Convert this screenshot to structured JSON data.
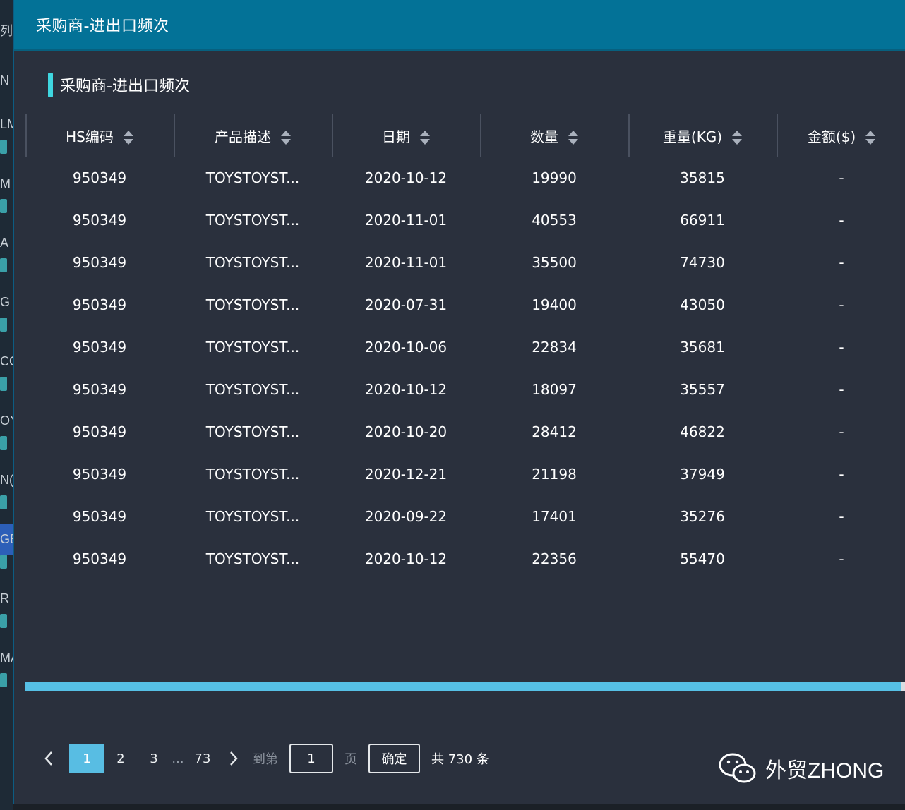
{
  "background_fragments": [
    "列",
    "N",
    "LM",
    "M",
    "A",
    "G",
    "CO",
    "OY",
    "N(",
    "GE",
    "R",
    "MA"
  ],
  "modal": {
    "header_title": "采购商-进出口频次",
    "section_title": "采购商-进出口频次"
  },
  "table": {
    "columns": [
      "HS编码",
      "产品描述",
      "日期",
      "数量",
      "重量(KG)",
      "金额($)"
    ],
    "rows": [
      [
        "950349",
        "TOYSTOYST...",
        "2020-10-12",
        "19990",
        "35815",
        "-"
      ],
      [
        "950349",
        "TOYSTOYST...",
        "2020-11-01",
        "40553",
        "66911",
        "-"
      ],
      [
        "950349",
        "TOYSTOYST...",
        "2020-11-01",
        "35500",
        "74730",
        "-"
      ],
      [
        "950349",
        "TOYSTOYST...",
        "2020-07-31",
        "19400",
        "43050",
        "-"
      ],
      [
        "950349",
        "TOYSTOYST...",
        "2020-10-06",
        "22834",
        "35681",
        "-"
      ],
      [
        "950349",
        "TOYSTOYST...",
        "2020-10-12",
        "18097",
        "35557",
        "-"
      ],
      [
        "950349",
        "TOYSTOYST...",
        "2020-10-20",
        "28412",
        "46822",
        "-"
      ],
      [
        "950349",
        "TOYSTOYST...",
        "2020-12-21",
        "21198",
        "37949",
        "-"
      ],
      [
        "950349",
        "TOYSTOYST...",
        "2020-09-22",
        "17401",
        "35276",
        "-"
      ],
      [
        "950349",
        "TOYSTOYST...",
        "2020-10-12",
        "22356",
        "55470",
        "-"
      ]
    ]
  },
  "pagination": {
    "pages": [
      "1",
      "2",
      "3"
    ],
    "ellipsis": "...",
    "last_page": "73",
    "goto_label": "到第",
    "goto_value": "1",
    "page_unit": "页",
    "confirm_label": "确定",
    "total_text": "共 730 条",
    "current_page": 1
  },
  "watermark": "外贸ZHONG",
  "colors": {
    "header_bg": "#037297",
    "modal_bg": "#2a303d",
    "accent": "#3fd6e0",
    "active_page": "#58bde3",
    "scrollbar": "#56c0e6"
  },
  "icons": [
    "sort-icon",
    "chevron-left-icon",
    "chevron-right-icon",
    "wechat-icon"
  ]
}
